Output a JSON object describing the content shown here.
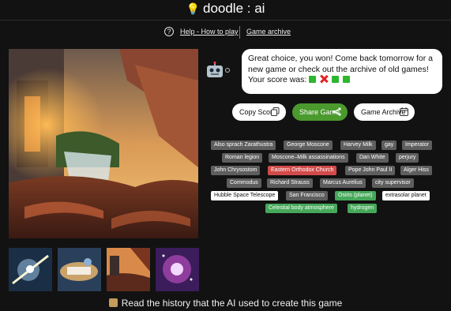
{
  "header": {
    "title": "doodle : ai",
    "icon": "lightbulb-icon"
  },
  "nav": {
    "help_label": "Help - How to play",
    "archive_label": "Game archive"
  },
  "message": {
    "text": "Great choice, you won! Come back tomorrow for a new game or check out the archive of old games! Your score was:",
    "score": [
      "green",
      "cross",
      "green",
      "green"
    ]
  },
  "buttons": {
    "copy": "Copy Score",
    "share": "Share Game",
    "archive": "Game Archive"
  },
  "tags": [
    {
      "label": "Also sprach Zarathustra",
      "state": "grey"
    },
    {
      "label": "George Moscone",
      "state": "grey"
    },
    {
      "label": "Harvey Milk",
      "state": "grey"
    },
    {
      "label": "gay",
      "state": "grey"
    },
    {
      "label": "Imperator",
      "state": "grey"
    },
    {
      "label": "Roman legion",
      "state": "grey"
    },
    {
      "label": "Moscone–Milk assassinations",
      "state": "grey"
    },
    {
      "label": "Dan White",
      "state": "grey"
    },
    {
      "label": "perjury",
      "state": "grey"
    },
    {
      "label": "John Chrysostom",
      "state": "grey"
    },
    {
      "label": "Eastern Orthodox Church",
      "state": "red"
    },
    {
      "label": "Pope John Paul II",
      "state": "grey"
    },
    {
      "label": "Alger Hiss",
      "state": "grey"
    },
    {
      "label": "Commodus",
      "state": "grey"
    },
    {
      "label": "Richard Strauss",
      "state": "grey"
    },
    {
      "label": "Marcus Aurelius",
      "state": "grey"
    },
    {
      "label": "city supervisor",
      "state": "grey"
    },
    {
      "label": "Hubble Space Telescope",
      "state": "white"
    },
    {
      "label": "San Francisco",
      "state": "grey"
    },
    {
      "label": "Osiris (planet)",
      "state": "green"
    },
    {
      "label": "extrasolar planet",
      "state": "white"
    },
    {
      "label": "Celestial body atmosphere",
      "state": "green"
    },
    {
      "label": "hydrogen",
      "state": "green"
    }
  ],
  "footer": {
    "text": "Read the history that the AI used to create this game",
    "icon": "scroll-icon"
  },
  "colors": {
    "background": "#121212",
    "share": "#4a9a2e",
    "tag_grey": "#5e5e5e",
    "tag_red": "#d24b4b",
    "tag_green": "#46a85a"
  }
}
